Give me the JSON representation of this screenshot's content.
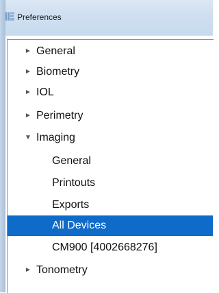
{
  "window": {
    "title": "Preferences"
  },
  "tree": {
    "items": [
      {
        "label": "General",
        "expander": "►"
      },
      {
        "label": "Biometry",
        "expander": "►"
      },
      {
        "label": "IOL",
        "expander": "►"
      },
      {
        "label": "Perimetry",
        "expander": "►"
      },
      {
        "label": "Imaging",
        "expander": "▼"
      },
      {
        "label": "General"
      },
      {
        "label": "Printouts"
      },
      {
        "label": "Exports"
      },
      {
        "label": "All Devices",
        "selected": true
      },
      {
        "label": "CM900 [4002668276]"
      },
      {
        "label": "Tonometry",
        "expander": "►"
      }
    ]
  },
  "colors": {
    "selection": "#0f6bc9",
    "titlebar": "#cfdff0"
  },
  "icons": {
    "app": "app-logo-icon",
    "collapsed": "triangle-right-icon",
    "expanded": "triangle-down-icon"
  }
}
